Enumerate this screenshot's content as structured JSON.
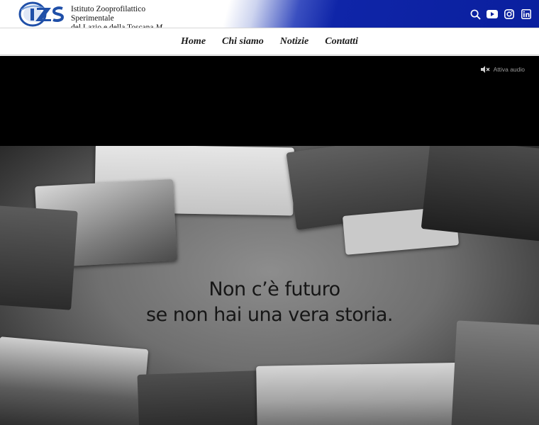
{
  "header": {
    "logo_text": "IZS",
    "org_name_line1": "Istituto Zooprofilattico Sperimentale",
    "org_name_line2": "del Lazio e della Toscana",
    "org_name_suffix": "M. Aleandri"
  },
  "icons": [
    "search-icon",
    "youtube-icon",
    "instagram-icon",
    "linkedin-icon"
  ],
  "nav": {
    "items": [
      {
        "label": "Home"
      },
      {
        "label": "Chi siamo"
      },
      {
        "label": "Notizie"
      },
      {
        "label": "Contatti"
      }
    ]
  },
  "video": {
    "audio_label": "Attiva audio",
    "tagline_line1": "Non c’è futuro",
    "tagline_line2": "se non hai una vera storia."
  },
  "colors": {
    "brand_blue": "#0a1f9e",
    "logo_blue": "#1f4fa8"
  }
}
